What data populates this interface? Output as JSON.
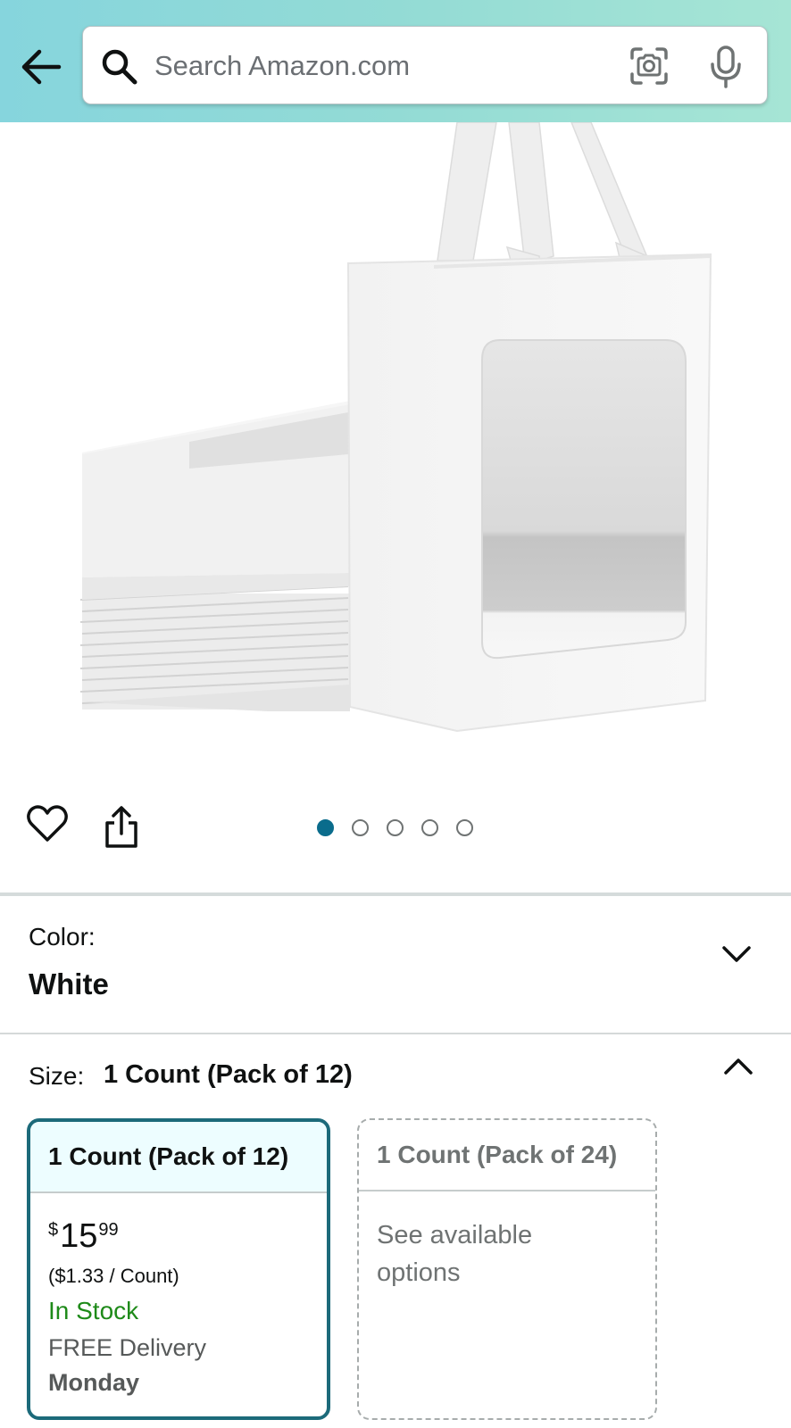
{
  "header": {
    "search_placeholder": "Search Amazon.com"
  },
  "icons": {
    "back": "back-arrow-icon",
    "search": "search-icon",
    "camera": "camera-lens-icon",
    "mic": "microphone-icon",
    "wishlist": "heart-icon",
    "share": "share-icon",
    "expand": "chevron-down-icon",
    "collapse": "chevron-up-icon"
  },
  "carousel": {
    "total_images": 5,
    "active_index": 0
  },
  "color": {
    "label": "Color:",
    "value": "White"
  },
  "size": {
    "label": "Size:",
    "value": "1 Count (Pack of 12)",
    "options": [
      {
        "title": "1 Count (Pack of 12)",
        "selected": true,
        "price_symbol": "$",
        "price_whole": "15",
        "price_fraction": "99",
        "unit_price": "($1.33 / Count)",
        "stock": "In Stock",
        "delivery": "FREE Delivery",
        "delivery_day": "Monday"
      },
      {
        "title": "1 Count (Pack of 24)",
        "selected": false,
        "note": "See available options"
      }
    ]
  },
  "colors": {
    "header_gradient_start": "#86d5dd",
    "header_gradient_end": "#a6e5d5",
    "selected_border": "#1c6a7a",
    "in_stock": "#1e8a19",
    "active_dot": "#0a6c8c"
  }
}
